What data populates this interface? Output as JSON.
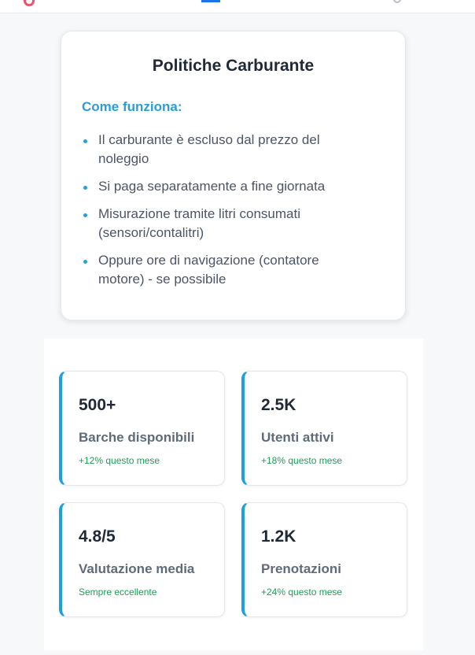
{
  "fuel_policy": {
    "title": "Politiche Carburante",
    "subhead": "Come funziona:",
    "items": [
      "Il carburante è escluso dal prezzo del noleggio",
      "Si paga separatamente a fine giornata",
      "Misurazione tramite litri consumati (sensori/contalitri)",
      "Oppure ore di navigazione (contatore motore) - se possibile"
    ]
  },
  "stats": [
    {
      "value": "500+",
      "label": "Barche disponibili",
      "trend": "+12% questo mese"
    },
    {
      "value": "2.5K",
      "label": "Utenti attivi",
      "trend": "+18% questo mese"
    },
    {
      "value": "4.8/5",
      "label": "Valutazione media",
      "trend": "Sempre eccellente"
    },
    {
      "value": "1.2K",
      "label": "Prenotazioni",
      "trend": "+24% questo mese"
    }
  ],
  "colors": {
    "accent": "#1e9fe0",
    "subhead": "#2a9fd6",
    "trend": "#1f9d55",
    "brand_icon": "#f0506e"
  },
  "icons": {
    "top_left": "brand-logo-icon",
    "top_right": "search-icon"
  }
}
